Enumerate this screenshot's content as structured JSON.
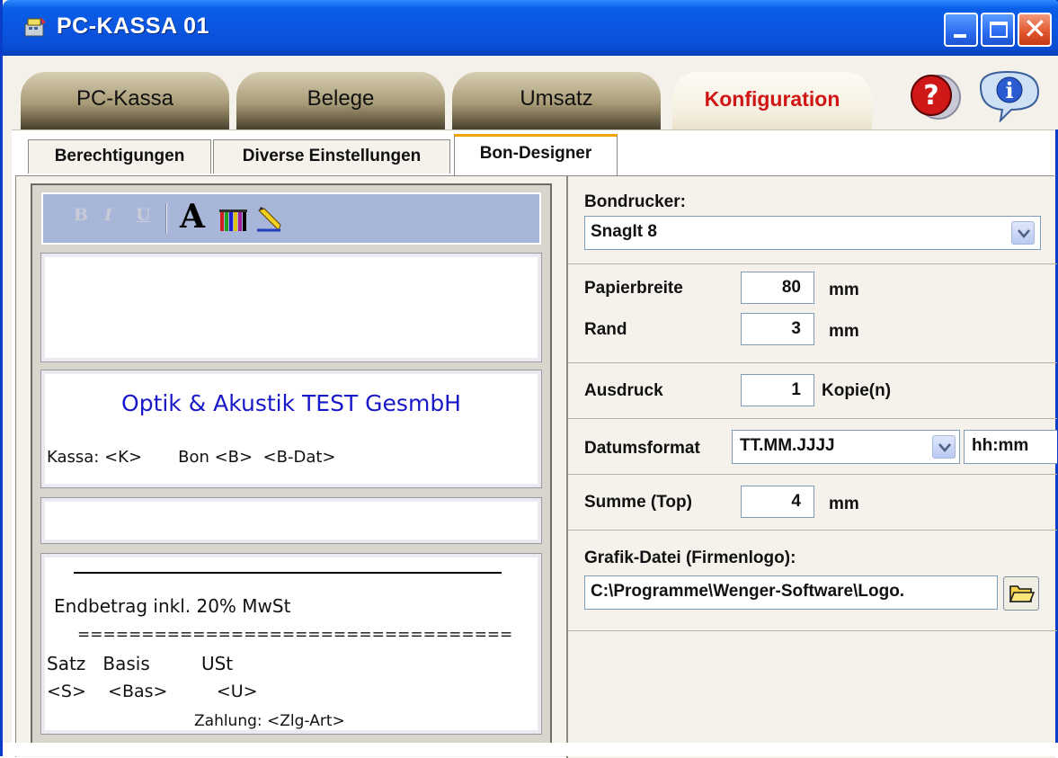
{
  "window": {
    "title": "PC-KASSA  01"
  },
  "main_tabs": [
    {
      "label": "PC-Kassa",
      "active": false
    },
    {
      "label": "Belege",
      "active": false
    },
    {
      "label": "Umsatz",
      "active": false
    },
    {
      "label": "Konfiguration",
      "active": true
    }
  ],
  "sub_tabs": [
    {
      "label": "Berechtigungen",
      "active": false
    },
    {
      "label": "Diverse Einstellungen",
      "active": false
    },
    {
      "label": "Bon-Designer",
      "active": true
    }
  ],
  "toolbar": {
    "bold_label": "B",
    "italic_label": "I",
    "underline_label": "U",
    "font_label": "A"
  },
  "receipt": {
    "company": "Optik & Akustik TEST GesmbH",
    "kassa_line": "Kassa: <K>       Bon <B>  <B-Dat>",
    "endbetrag": "Endbetrag inkl. 20% MwSt",
    "equals": "==================================",
    "tax_header": "Satz   Basis         USt",
    "tax_values": "<S>    <Bas>         <U>",
    "zahlung": "Zahlung: <Zlg-Art>"
  },
  "settings": {
    "bondrucker_label": "Bondrucker:",
    "bondrucker_value": "SnagIt 8",
    "papierbreite_label": "Papierbreite",
    "papierbreite_value": "80",
    "papierbreite_unit": "mm",
    "rand_label": "Rand",
    "rand_value": "3",
    "rand_unit": "mm",
    "ausdruck_label": "Ausdruck",
    "ausdruck_value": "1",
    "ausdruck_unit": "Kopie(n)",
    "datumsformat_label": "Datumsformat",
    "datumsformat_value": "TT.MM.JJJJ",
    "zeitformat_value": "hh:mm",
    "summe_label": "Summe (Top)",
    "summe_value": "4",
    "summe_unit": "mm",
    "grafik_label": "Grafik-Datei (Firmenlogo):",
    "grafik_value": "C:\\Programme\\Wenger-Software\\Logo."
  },
  "colors": {
    "titlebar": "#0b55e0",
    "active_tab_text": "#d01515",
    "company_text": "#1818c8",
    "toolbar_bg": "#a8b6da"
  }
}
